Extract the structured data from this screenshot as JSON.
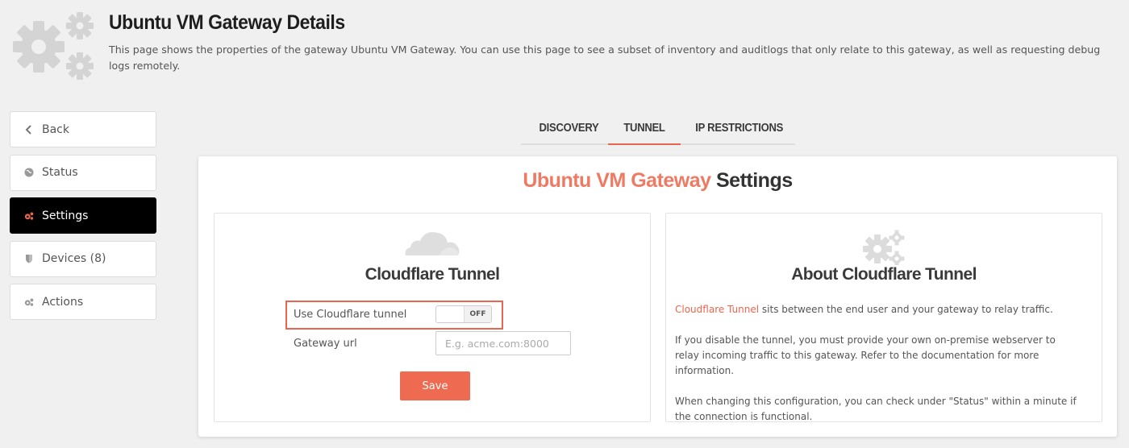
{
  "header": {
    "title": "Ubuntu VM Gateway Details",
    "description": "This page shows the properties of the gateway Ubuntu VM Gateway. You can use this page to see a subset of inventory and auditlogs that only relate to this gateway, as well as requesting debug logs remotely.",
    "icon": "gears-icon"
  },
  "sidebar": {
    "items": [
      {
        "label": "Back",
        "icon": "chevron-left-icon"
      },
      {
        "label": "Status",
        "icon": "globe-icon"
      },
      {
        "label": "Settings",
        "icon": "gears-icon",
        "active": true
      },
      {
        "label": "Devices (8)",
        "icon": "shield-icon"
      },
      {
        "label": "Actions",
        "icon": "gears-icon"
      }
    ]
  },
  "tabs": [
    {
      "label": "DISCOVERY"
    },
    {
      "label": "TUNNEL",
      "active": true
    },
    {
      "label": "IP RESTRICTIONS"
    }
  ],
  "settings": {
    "title_accent": "Ubuntu VM Gateway",
    "title_rest": " Settings",
    "tunnel_panel": {
      "title": "Cloudflare Tunnel",
      "icon": "cloud-icon",
      "use_tunnel_label": "Use Cloudflare tunnel",
      "toggle_state": "OFF",
      "gateway_url_label": "Gateway url",
      "gateway_url_value": "",
      "gateway_url_placeholder": "E.g. acme.com:8000",
      "save_label": "Save"
    },
    "about_panel": {
      "title": "About Cloudflare Tunnel",
      "icon": "gears-icon",
      "link_text": "Cloudflare Tunnel",
      "p1_rest": " sits between the end user and your gateway to relay traffic.",
      "p2": "If you disable the tunnel, you must provide your own on-premise webserver to relay incoming traffic to this gateway. Refer to the documentation for more information.",
      "p3": "When changing this configuration, you can check under \"Status\" within a minute if the connection is functional."
    }
  },
  "colors": {
    "accent": "#e8654f",
    "button": "#ee6a50",
    "active_sidebar_bg": "#000000"
  }
}
